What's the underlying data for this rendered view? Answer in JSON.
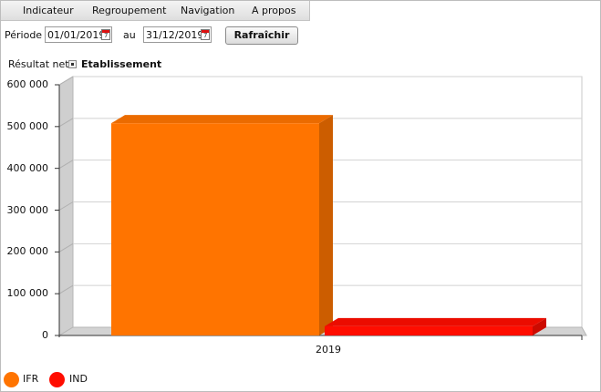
{
  "menu": {
    "items": [
      {
        "label": "Indicateur"
      },
      {
        "label": "Regroupement"
      },
      {
        "label": "Navigation"
      },
      {
        "label": "A propos"
      }
    ]
  },
  "toolbar": {
    "period_label": "Période",
    "start_date": "01/01/2019",
    "to_label": "au",
    "end_date": "31/12/2019",
    "refresh_label": "Rafraîchir"
  },
  "subtitle": {
    "metric": "Résultat net",
    "grouping": "Etablissement"
  },
  "colors": {
    "IFR": "#ff7400",
    "IND": "#ff0d00"
  },
  "chart_data": {
    "type": "bar",
    "categories": [
      "2019"
    ],
    "series": [
      {
        "name": "IFR",
        "values": [
          508000
        ]
      },
      {
        "name": "IND",
        "values": [
          22000
        ]
      }
    ],
    "y_ticks": [
      "0",
      "100 000",
      "200 000",
      "300 000",
      "400 000",
      "500 000",
      "600 000"
    ],
    "ylim": [
      0,
      600000
    ],
    "grid": true,
    "legend_position": "bottom-left"
  }
}
